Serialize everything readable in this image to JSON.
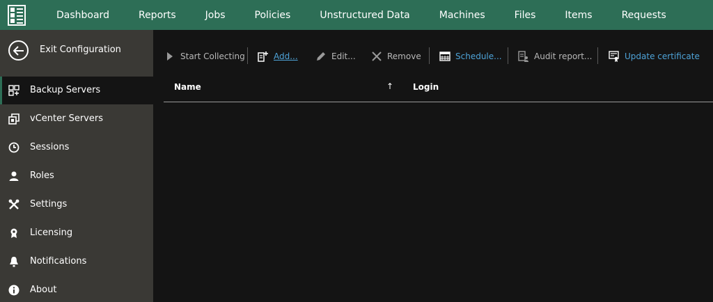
{
  "topnav": {
    "items": [
      "Dashboard",
      "Reports",
      "Jobs",
      "Policies",
      "Unstructured Data",
      "Machines",
      "Files",
      "Items",
      "Requests"
    ]
  },
  "sidebar": {
    "exit_label": "Exit Configuration",
    "items": [
      {
        "label": "Backup Servers",
        "icon": "backup-server-icon",
        "active": true
      },
      {
        "label": "vCenter Servers",
        "icon": "vcenter-icon"
      },
      {
        "label": "Sessions",
        "icon": "clock-icon"
      },
      {
        "label": "Roles",
        "icon": "user-icon"
      },
      {
        "label": "Settings",
        "icon": "tools-icon"
      },
      {
        "label": "Licensing",
        "icon": "license-icon"
      },
      {
        "label": "Notifications",
        "icon": "bell-icon"
      },
      {
        "label": "About",
        "icon": "info-icon"
      }
    ]
  },
  "toolbar": {
    "start_collecting": "Start Collecting",
    "add": "Add...",
    "edit": "Edit...",
    "remove": "Remove",
    "schedule": "Schedule...",
    "audit_report": "Audit report...",
    "update_certificate": "Update certificate"
  },
  "table": {
    "columns": [
      "Name",
      "Login"
    ],
    "sort_indicator": "↑",
    "rows": []
  },
  "colors": {
    "accent": "#2d6e56",
    "sidebar": "#3a3935",
    "content": "#141414",
    "link": "#4ea3d8"
  }
}
